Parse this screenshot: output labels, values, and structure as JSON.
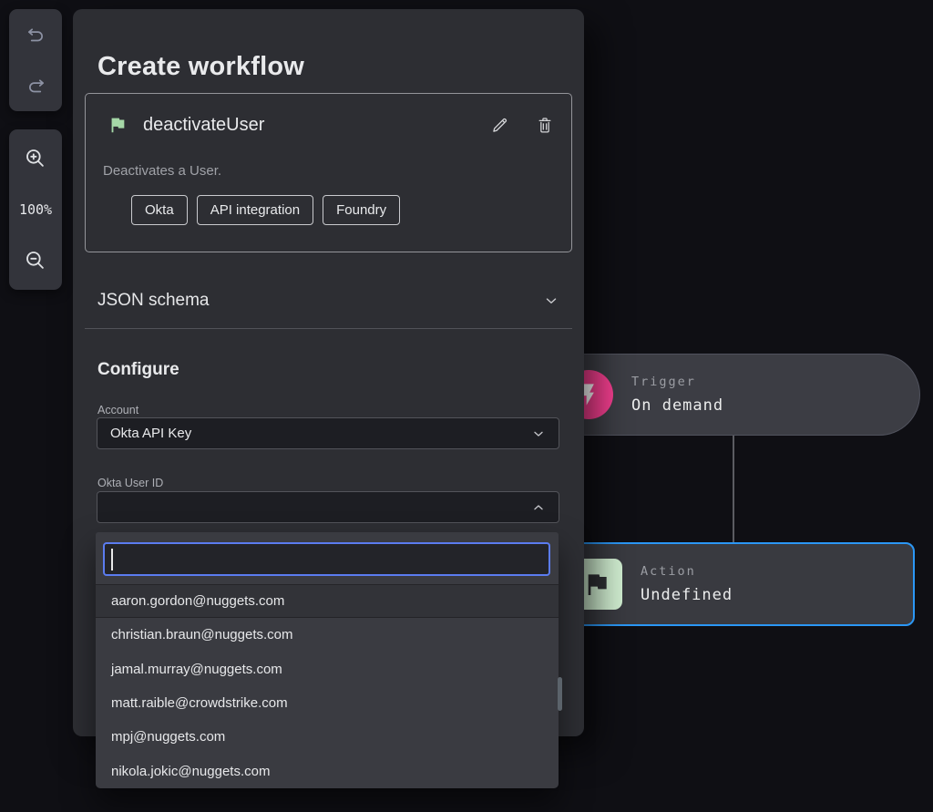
{
  "toolbar": {
    "zoom_level": "100%"
  },
  "panel": {
    "title": "Create workflow",
    "card": {
      "name": "deactivateUser",
      "description": "Deactivates a User.",
      "tags": [
        "Okta",
        "API integration",
        "Foundry"
      ]
    },
    "json_schema_label": "JSON schema",
    "configure": {
      "heading": "Configure",
      "account_label": "Account",
      "account_value": "Okta API Key",
      "user_id_label": "Okta User ID",
      "user_id_value": ""
    }
  },
  "dropdown": {
    "search_value": "",
    "options": [
      "aaron.gordon@nuggets.com",
      "christian.braun@nuggets.com",
      "jamal.murray@nuggets.com",
      "matt.raible@crowdstrike.com",
      "mpj@nuggets.com",
      "nikola.jokic@nuggets.com"
    ],
    "highlighted_option": "aaron.gordon@nuggets.com"
  },
  "canvas": {
    "trigger": {
      "kind": "Trigger",
      "value": "On demand"
    },
    "action": {
      "kind": "Action",
      "value": "Undefined"
    }
  },
  "colors": {
    "trigger_accent": "#f23e8e",
    "action_border": "#2b97f5",
    "action_icon_bg": "#cfeccf",
    "flag_green": "#a5d7a7",
    "focus_border": "#5b7cf0",
    "panel_bg": "#2d2e33",
    "dropdown_bg": "#3a3b41"
  }
}
